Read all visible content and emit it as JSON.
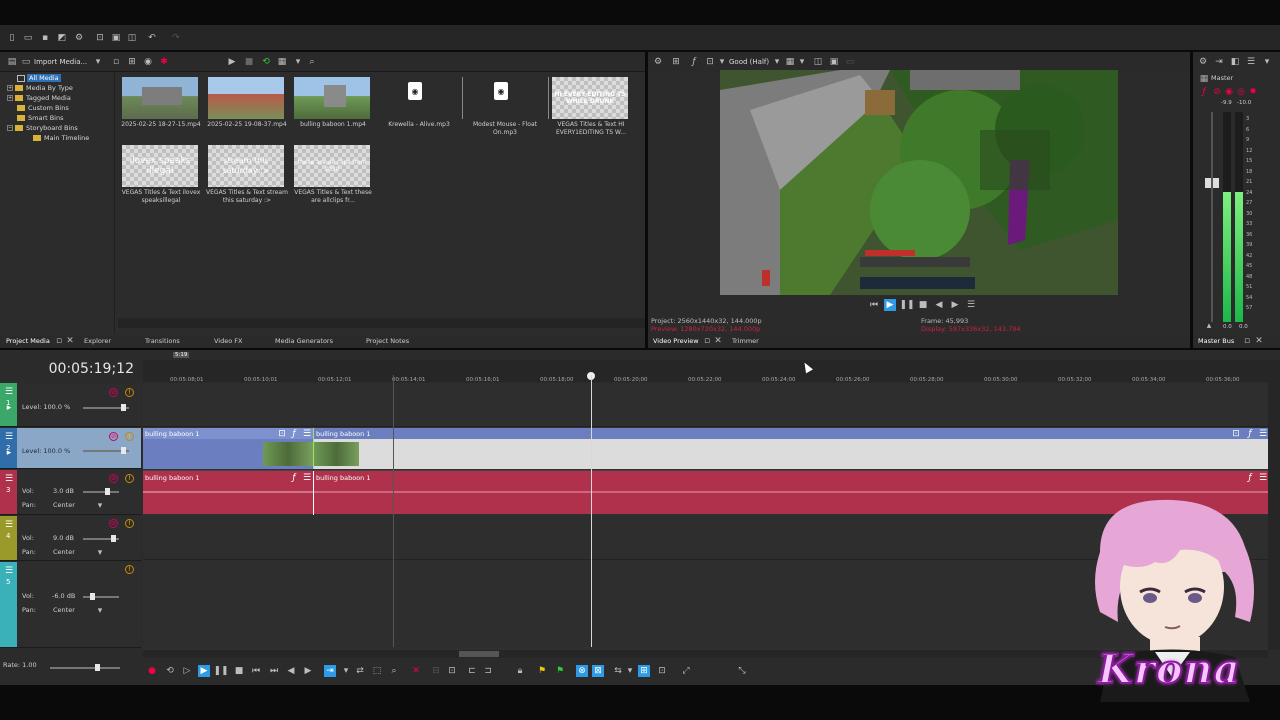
{
  "media": {
    "toolbar": {
      "import_label": "Import Media..."
    },
    "tree": [
      "All Media",
      "Media By Type",
      "Tagged Media",
      "Custom Bins",
      "Smart Bins",
      "Storyboard Bins",
      "Main Timeline"
    ],
    "files": [
      {
        "name": "2025-02-25 18-27-15.mp4",
        "kind": "video"
      },
      {
        "name": "2025-02-25 19-08-37.mp4",
        "kind": "video"
      },
      {
        "name": "bulling baboon 1.mp4",
        "kind": "video"
      },
      {
        "name": "Krewella - Alive.mp3",
        "kind": "audio"
      },
      {
        "name": "Modest Mouse - Float On.mp3",
        "kind": "audio"
      },
      {
        "name": "VEGAS Titles & Text HI EVERY1EDITING TS W...",
        "kind": "title",
        "thumb": "HI EVERY EDITING TS WHILE DRUNK"
      },
      {
        "name": "VEGAS Titles & Text ilovex speaksillegal",
        "kind": "title",
        "thumb": "ilovex speaks illegal"
      },
      {
        "name": "VEGAS Titles & Text stream this saturday :>",
        "kind": "title",
        "thumb": "stream this saturday :>"
      },
      {
        "name": "VEGAS Titles & Text these are allclips fr...",
        "kind": "title",
        "thumb": "these are all clips from 2020"
      }
    ],
    "tabs": [
      "Project Media",
      "Explorer",
      "Transitions",
      "Video FX",
      "Media Generators",
      "Project Notes"
    ]
  },
  "preview": {
    "quality": "Good (Half)",
    "project": "Project:  2560x1440x32, 144.000p",
    "preview_res": "Preview:  1280x720x32, 144.000p",
    "frame": "Frame:    45,993",
    "display": "Display:  597x336x32, 143.794",
    "tabs": [
      "Video Preview",
      "Trimmer"
    ]
  },
  "mixer": {
    "title": "Master",
    "tab": "Master Bus",
    "peak_l": "-9.9",
    "peak_r": "-10.0",
    "scale": [
      "3",
      "6",
      "9",
      "12",
      "15",
      "18",
      "21",
      "24",
      "27",
      "30",
      "33",
      "36",
      "39",
      "42",
      "45",
      "48",
      "51",
      "54",
      "57"
    ],
    "zero_l": "0.0",
    "zero_r": "0.0"
  },
  "timeline": {
    "timecode": "00:05:19;12",
    "ruler": [
      "00:05:08;01",
      "00:05:10;01",
      "00:05:12;01",
      "00:05:14;01",
      "00:05:16;01",
      "00:05:18;00",
      "00:05:20;00",
      "00:05:22;00",
      "00:05:24;00",
      "00:05:26;00",
      "00:05:28;00",
      "00:05:30;00",
      "00:05:32;00",
      "00:05:34;00",
      "00:05:36;00"
    ],
    "loop_marker": "5:19",
    "tracks": [
      {
        "num": "1",
        "level": "Level: 100.0 %"
      },
      {
        "num": "2",
        "level": "Level: 100.0 %"
      },
      {
        "num": "3",
        "vol": "Vol:",
        "vol_val": "3.0 dB",
        "pan": "Pan:",
        "pan_val": "Center"
      },
      {
        "num": "4",
        "vol": "Vol:",
        "vol_val": "9.0 dB",
        "pan": "Pan:",
        "pan_val": "Center"
      },
      {
        "num": "5",
        "vol": "Vol:",
        "vol_val": "-6.0 dB",
        "pan": "Pan:",
        "pan_val": "Center"
      }
    ],
    "clips": {
      "video_a": "bulling baboon 1",
      "video_b": "bulling baboon 1",
      "audio_a": "bulling baboon 1",
      "audio_b": "bulling baboon 1"
    },
    "rate": "Rate: 1.00"
  },
  "overlay": {
    "watermark": "Krona"
  },
  "colors": {
    "video_track": "#6b7fc0",
    "audio_track": "#b0314c",
    "accent": "#2d9be6"
  }
}
